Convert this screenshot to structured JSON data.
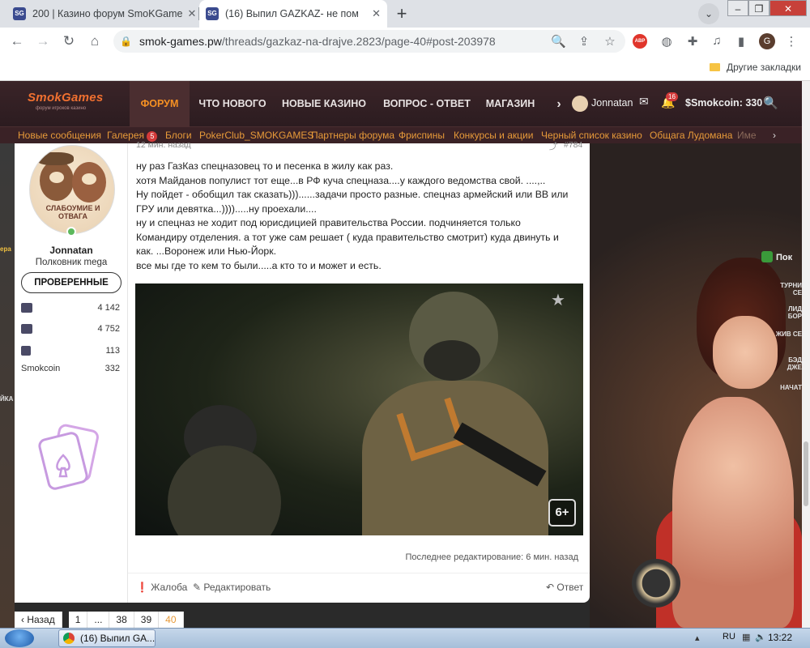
{
  "browser": {
    "tabs": [
      {
        "title": "200 | Казино форум SmoKGame",
        "active": false
      },
      {
        "title": "(16) Выпил GAZKAZ- не пом",
        "active": true
      }
    ],
    "new_tab": "+",
    "url_host": "smok-games.pw",
    "url_path": "/threads/gazkaz-na-drajve.2823/page-40#post-203978",
    "abp_badge": "ABP",
    "profile_initial": "G",
    "bookmarks_other": "Другие закладки"
  },
  "site": {
    "logo": "SmokGames",
    "logo_sub": "форум игроков казино",
    "nav": [
      "ФОРУМ",
      "ЧТО НОВОГО",
      "НОВЫЕ КАЗИНО",
      "ВОПРОС - ОТВЕТ",
      "МАГАЗИН",
      "›"
    ],
    "username": "Jonnatan",
    "alerts_count": "16",
    "smokcoin": "Smokcoin: 330",
    "subnav": [
      {
        "label": "Новые сообщения"
      },
      {
        "label": "Галерея",
        "badge": "5"
      },
      {
        "label": "Блоги"
      },
      {
        "label": "PokerClub_SMOKGAMES"
      },
      {
        "label": "Партнеры форума"
      },
      {
        "label": "Фриспины"
      },
      {
        "label": "Конкурсы и акции"
      },
      {
        "label": "Черный список казино"
      },
      {
        "label": "Общага Лудомана"
      },
      {
        "label": "Име"
      },
      {
        "label": "›"
      }
    ],
    "right_side": [
      "Пок",
      "ТУРНИ СЕ",
      "ЛИД БОР",
      "ЖИВ СЕ",
      "БЭД ДЖЕ",
      "НАЧАТ"
    ],
    "left_side": [
      "ера",
      "ЙКА"
    ]
  },
  "post": {
    "user": {
      "avatar_text": "СЛАБОУМИЕ И ОТВАГА",
      "name": "Jonnatan",
      "title": "Полковник mega",
      "group": "ПРОВЕРЕННЫЕ",
      "stats": [
        {
          "icon": "messages-icon",
          "value": "4 142"
        },
        {
          "icon": "likes-icon",
          "value": "4 752"
        },
        {
          "icon": "trophy-icon",
          "value": "113"
        },
        {
          "label": "Smokcoin",
          "value": "332"
        }
      ]
    },
    "time": "12 мин. назад",
    "number": "#784",
    "lines": [
      "ну раз ГазКаз спецназовец то и песенка в жилу как раз.",
      "хотя Майданов популист тот еще...в РФ куча спецназа....у каждого ведомства свой. ....,..",
      "Ну пойдет - обобщил так сказать)))......задачи просто разные. спецназ армейский или ВВ или",
      "ГРУ или девятка...)))).....ну проехали....",
      "ну и спецназ не ходит под юрисдицией правительства России. подчиняется только",
      "Командиру отделения. а тот уже сам решает ( куда правительство смотрит) куда двинуть и",
      "как. ...Воронеж или Нью-Йорк.",
      "все мы где то кем то были.....а кто то и может и есть."
    ],
    "video_age_badge": "6+",
    "last_edit": "Последнее редактирование: 6 мин. назад",
    "report": "Жалоба",
    "edit": "Редактировать",
    "reply": "Ответ"
  },
  "pagination": [
    "‹ Назад",
    "1",
    "...",
    "38",
    "39",
    "40"
  ],
  "taskbar": {
    "app_title": "(16) Выпил GA...",
    "lang": "RU",
    "time": "13:22"
  }
}
